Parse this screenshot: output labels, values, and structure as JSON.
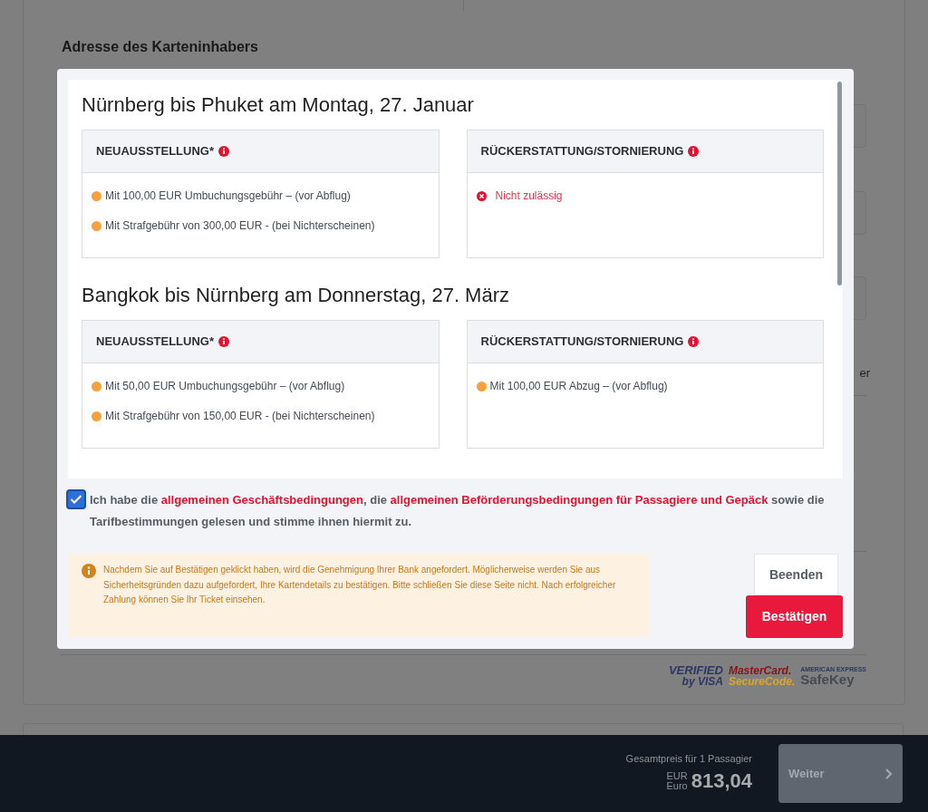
{
  "background_page": {
    "heading": "Adresse des Karteninhabers",
    "partial_label": "er",
    "security_logos": [
      {
        "kind": "visa",
        "line_1": "VERIFIED",
        "line_2": "by VISA"
      },
      {
        "kind": "mastercard",
        "line_1": "MasterCard.",
        "line_2": "SecureCode."
      },
      {
        "kind": "amex",
        "line_1": "AMERICAN EXPRESS",
        "line_2": "SafeKey"
      }
    ]
  },
  "footer": {
    "total_label": "Gesamtpreis für 1 Passagier",
    "currency_code": "EUR",
    "currency_name": "Euro",
    "amount": "813,04",
    "next_button": "Weiter",
    "next_disabled": true
  },
  "modal": {
    "sections": [
      {
        "title": "Nürnberg bis Phuket am Montag, 27. Januar",
        "panels": [
          {
            "heading": "NEUAUSSTELLUNG*",
            "items": [
              {
                "kind": "fee",
                "text": "Mit 100,00 EUR Umbuchungsgebühr – (vor Abflug)"
              },
              {
                "kind": "fee",
                "text": "Mit Strafgebühr von 300,00 EUR - (bei Nichterscheinen)"
              }
            ]
          },
          {
            "heading": "RÜCKERSTATTUNG/STORNIERUNG",
            "items": [
              {
                "kind": "not_allowed",
                "text": "Nicht zulässig"
              }
            ]
          }
        ]
      },
      {
        "title": "Bangkok bis Nürnberg am Donnerstag, 27. März",
        "panels": [
          {
            "heading": "NEUAUSSTELLUNG*",
            "items": [
              {
                "kind": "fee",
                "text": "Mit 50,00 EUR Umbuchungsgebühr – (vor Abflug)"
              },
              {
                "kind": "fee",
                "text": "Mit Strafgebühr von 150,00 EUR - (bei Nichterscheinen)"
              }
            ]
          },
          {
            "heading": "RÜCKERSTATTUNG/STORNIERUNG",
            "items": [
              {
                "kind": "fee",
                "text": "Mit 100,00 EUR Abzug – (vor Abflug)"
              }
            ]
          }
        ]
      }
    ],
    "consent": {
      "checked": true,
      "parts": [
        {
          "kind": "text",
          "text": "Ich habe die "
        },
        {
          "kind": "link",
          "text": "allgemeinen Geschäftsbedingungen"
        },
        {
          "kind": "text",
          "text": ", die "
        },
        {
          "kind": "link",
          "text": "allgemeinen Beförderungsbedingungen für Passagiere und Gepäck"
        },
        {
          "kind": "text",
          "text": " sowie die Tarifbestimmungen gelesen und stimme ihnen hiermit zu."
        }
      ]
    },
    "notice": "Nachdem Sie auf Bestätigen geklickt haben, wird die Genehmigung Ihrer Bank angefordert. Möglicherweise werden Sie aus Sicherheitsgründen dazu aufgefordert, Ihre Kartendetails zu bestätigen. Bitte schließen Sie diese Seite nicht. Nach erfolgreicher Zahlung können Sie Ihr Ticket einsehen.",
    "buttons": [
      {
        "kind": "secondary",
        "label": "Beenden"
      },
      {
        "kind": "primary",
        "label": "Bestätigen"
      }
    ]
  }
}
